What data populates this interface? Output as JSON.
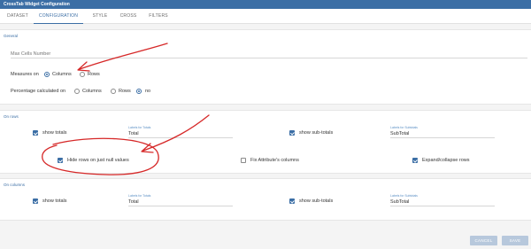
{
  "window": {
    "title": "CrossTab Widget Configuration"
  },
  "tabs": [
    {
      "label": "DATASET"
    },
    {
      "label": "CONFIGURATION"
    },
    {
      "label": "STYLE"
    },
    {
      "label": "CROSS"
    },
    {
      "label": "FILTERS"
    }
  ],
  "general": {
    "title": "General",
    "max_cells_placeholder": "Max Cells Number",
    "measures_label": "Measures on",
    "measures_options": [
      "Columns",
      "Rows"
    ],
    "measures_selected": "Columns",
    "percentage_label": "Percentage calculated on",
    "percentage_options": [
      "Columns",
      "Rows",
      "no"
    ],
    "percentage_selected": "no"
  },
  "on_rows": {
    "title": "On rows",
    "show_totals": {
      "label": "show totals",
      "checked": true
    },
    "totals_label_caption": "Labels for Totals",
    "totals_label_value": "Total",
    "show_subtotals": {
      "label": "show sub-totals",
      "checked": true
    },
    "subtotals_label_caption": "Labels for Subtotals",
    "subtotals_label_value": "SubTotal",
    "hide_null": {
      "label": "Hide rows on just null values",
      "checked": true
    },
    "fix_attributes": {
      "label": "Fix Attribute's columns",
      "checked": false
    },
    "expand_collapse": {
      "label": "Expand/collapse rows",
      "checked": true
    }
  },
  "on_columns": {
    "title": "On columns",
    "show_totals": {
      "label": "show totals",
      "checked": true
    },
    "totals_label_caption": "Labels for Totals",
    "totals_label_value": "Total",
    "show_subtotals": {
      "label": "show sub-totals",
      "checked": true
    },
    "subtotals_label_caption": "Labels for Subtotals",
    "subtotals_label_value": "SubTotal"
  },
  "footer": {
    "cancel_label": "CANCEL",
    "save_label": "SAVE"
  },
  "colors": {
    "accent": "#3b6ea5",
    "annotation": "#d62828",
    "button": "#b7c8dc"
  }
}
